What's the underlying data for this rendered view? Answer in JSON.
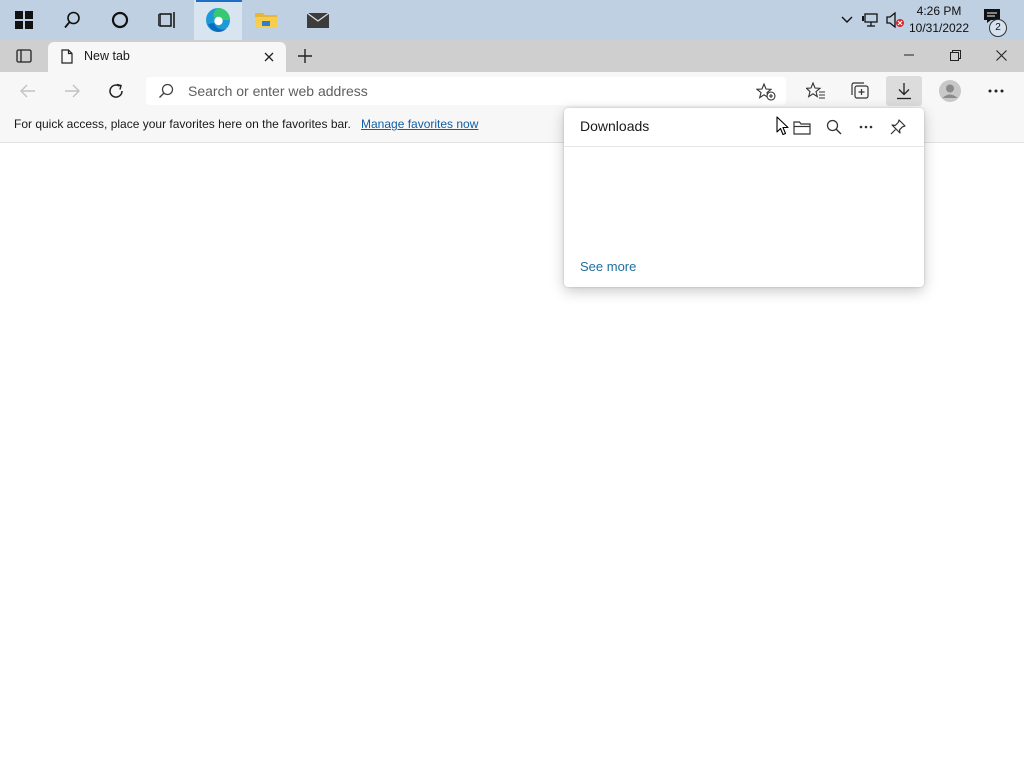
{
  "taskbar": {
    "apps": [
      {
        "name": "start",
        "icon": "windows-logo-icon"
      },
      {
        "name": "search",
        "icon": "search-icon"
      },
      {
        "name": "cortana",
        "icon": "cortana-ring-icon"
      },
      {
        "name": "task-view",
        "icon": "task-view-icon"
      },
      {
        "name": "edge",
        "icon": "edge-icon",
        "active": true
      },
      {
        "name": "file-explorer",
        "icon": "folder-icon"
      },
      {
        "name": "mail",
        "icon": "mail-icon"
      }
    ],
    "clock": {
      "time": "4:26 PM",
      "date": "10/31/2022"
    },
    "notification_count": "2"
  },
  "browser": {
    "tab_title": "New tab",
    "address_placeholder": "Search or enter web address",
    "favorites_bar": {
      "text": "For quick access, place your favorites here on the favorites bar.",
      "link": "Manage favorites now"
    },
    "downloads_panel": {
      "title": "Downloads",
      "see_more": "See more"
    }
  },
  "colors": {
    "taskbar_bg": "#bfd0e2",
    "tabstrip_bg": "#cfcfcf",
    "toolbar_bg": "#f7f7f7",
    "link": "#115ea3",
    "see_more": "#1f6f9f",
    "edge_accent": "#1c9bd8"
  }
}
